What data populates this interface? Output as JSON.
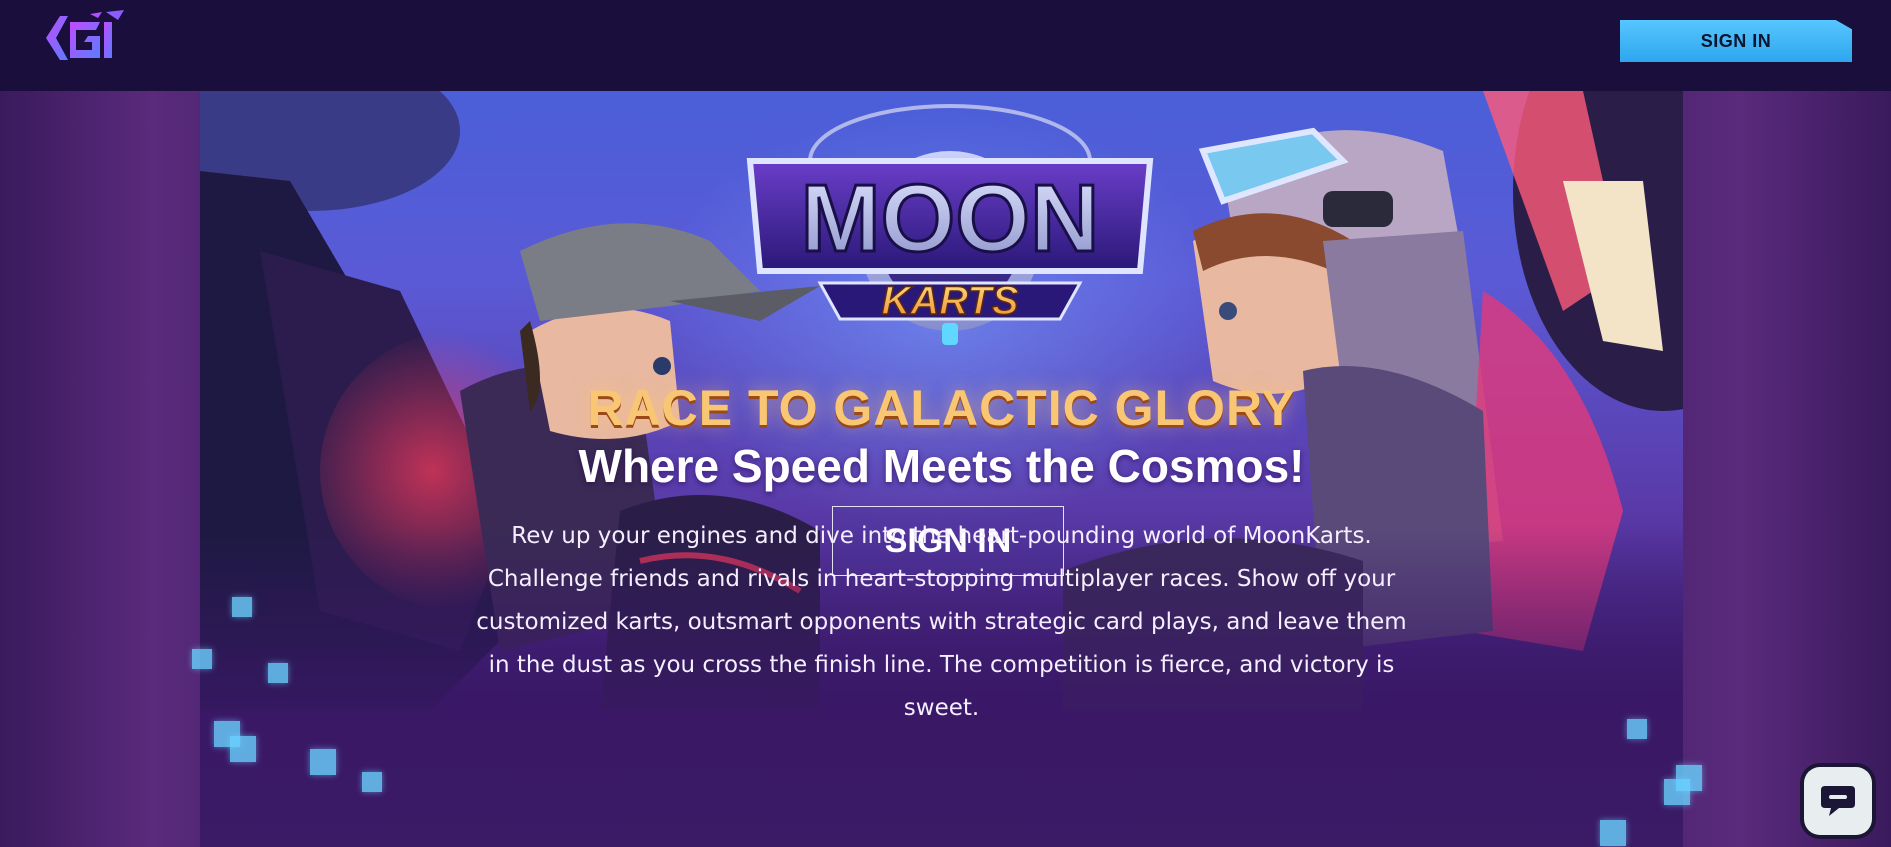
{
  "header": {
    "logo_icon": "kgi-logo-icon",
    "sign_in_label": "SIGN IN"
  },
  "hero": {
    "logo_word_top": "MOON",
    "logo_word_bottom": "KARTS",
    "tagline": "RACE TO GALACTIC GLORY",
    "subhead": "Where Speed Meets the Cosmos!",
    "cta_label": "SIGN IN",
    "description_lines": [
      "Rev up your engines and dive into the heart-pounding world of MoonKarts.",
      "Challenge friends and rivals in heart-stopping multiplayer races. Show off your",
      "customized karts, outsmart opponents with strategic card plays, and leave them",
      "in the dust as you cross the finish line. The competition is fierce, and victory is",
      "sweet."
    ]
  },
  "chat": {
    "icon": "chat-bubble-icon"
  },
  "colors": {
    "topbar": "#1a0e3c",
    "signin_button": "#4ab9f7",
    "tagline": "#f9c774",
    "accent_pixels": "#6ad2ff"
  }
}
